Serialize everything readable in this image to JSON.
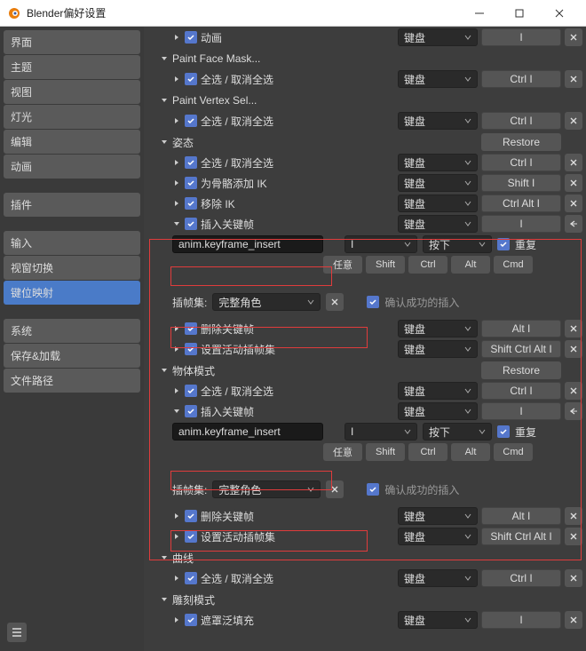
{
  "window": {
    "title": "Blender偏好设置"
  },
  "sidebar": {
    "groups": [
      [
        "界面",
        "主题",
        "视图",
        "灯光",
        "编辑",
        "动画"
      ],
      [
        "插件"
      ],
      [
        "输入",
        "视窗切换",
        "键位映射"
      ],
      [
        "系统",
        "保存&加载",
        "文件路径"
      ]
    ],
    "selected": "键位映射"
  },
  "types": {
    "keyboard": "键盘",
    "press": "按下"
  },
  "buttons": {
    "restore": "Restore",
    "any": "任意",
    "shift": "Shift",
    "ctrl": "Ctrl",
    "alt": "Alt",
    "cmd": "Cmd",
    "repeat": "重复"
  },
  "keys": {
    "I": "I",
    "ctrlI": "Ctrl I",
    "shiftI": "Shift I",
    "ctrlAltI": "Ctrl Alt I",
    "altI": "Alt I",
    "shiftCtrlAltI": "Shift Ctrl Alt I"
  },
  "rows": {
    "anim": "动画",
    "paintFace": "Paint Face Mask...",
    "selAll": "全选 / 取消全选",
    "paintVert": "Paint Vertex Sel...",
    "pose": "姿态",
    "addIK": "为骨骼添加 IK",
    "removeIK": "移除 IK",
    "insertKey": "插入关键帧",
    "operator": "anim.keyframe_insert",
    "insertSetLabel": "插帧集:",
    "insertSetValue": "完整角色",
    "confirmInsert": "确认成功的插入",
    "deleteKey": "删除关键帧",
    "setActiveSet": "设置活动插帧集",
    "objectMode": "物体模式",
    "curve": "曲线",
    "sculpt": "雕刻模式",
    "maskFill": "遮罩泛填充"
  }
}
